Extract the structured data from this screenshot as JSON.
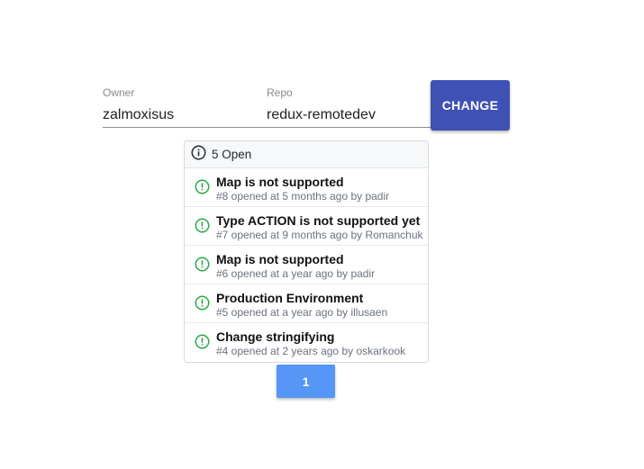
{
  "form": {
    "owner_label": "Owner",
    "owner_value": "zalmoxisus",
    "repo_label": "Repo",
    "repo_value": "redux-remotedev",
    "change_label": "CHANGE"
  },
  "issues": {
    "header_icon": "info-circle-icon",
    "open_count_label": "5 Open",
    "item_icon": "issue-opened-icon",
    "item_icon_color": "#28a745",
    "items": [
      {
        "title": "Map is not supported",
        "meta": "#8 opened at 5 months ago by padir"
      },
      {
        "title": "Type ACTION is not supported yet",
        "meta": "#7 opened at 9 months ago by Romanchuk"
      },
      {
        "title": "Map is not supported",
        "meta": "#6 opened at a year ago by padir"
      },
      {
        "title": "Production Environment",
        "meta": "#5 opened at a year ago by illusaen"
      },
      {
        "title": "Change stringifying",
        "meta": "#4 opened at 2 years ago by oskarkook"
      }
    ]
  },
  "pagination": {
    "current_page": "1"
  },
  "colors": {
    "primary_button": "#3f51b5",
    "page_button": "#5596f6"
  }
}
